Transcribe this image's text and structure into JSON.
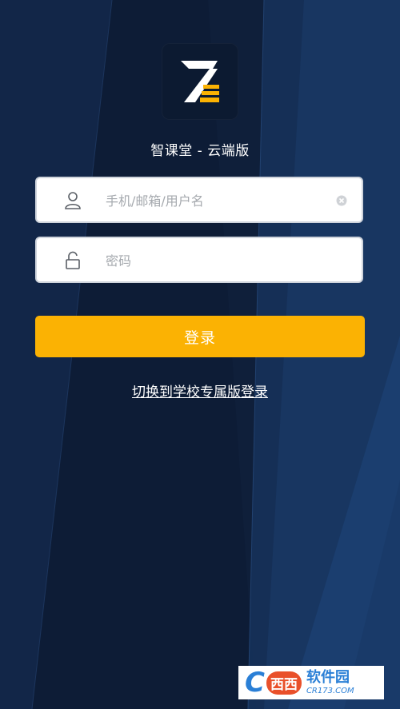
{
  "app": {
    "title": "智课堂 - 云端版"
  },
  "login_form": {
    "username_placeholder": "手机/邮箱/用户名",
    "username_value": "",
    "password_placeholder": "密码",
    "password_value": "",
    "submit_label": "登录"
  },
  "links": {
    "switch_school_login": "切换到学校专属版登录"
  },
  "watermark": {
    "logo_text": "西西",
    "name": "软件园",
    "url": "CR173.COM"
  },
  "colors": {
    "background": "#0f1f3a",
    "accent": "#fbb203",
    "field_border": "#cfd4dc",
    "placeholder": "#a5a9ae"
  },
  "icons": {
    "logo": "z-logo-icon",
    "username": "user-icon",
    "password": "unlock-icon",
    "clear": "clear-input-icon"
  }
}
